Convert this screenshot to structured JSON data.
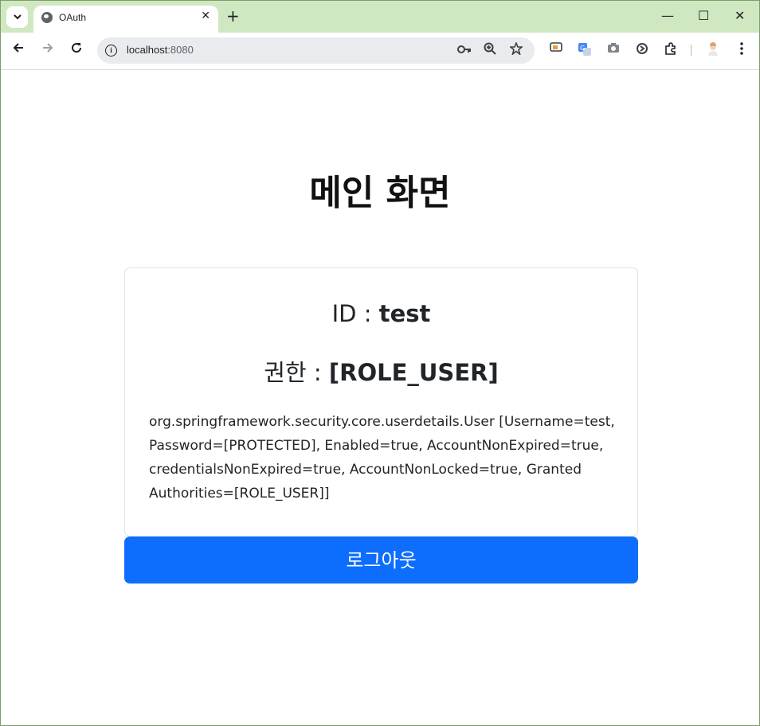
{
  "browser": {
    "tab_title": "OAuth",
    "tab_close": "✕",
    "new_tab": "+",
    "url_host": "localhost",
    "url_port": ":8080",
    "controls": {
      "minimize": "—",
      "maximize": "☐",
      "close": "✕"
    }
  },
  "main": {
    "heading": "메인 화면",
    "id_label": "ID : ",
    "id_value": "test",
    "role_label": "권한 : ",
    "role_value": "[ROLE_USER]",
    "detail_text": "org.springframework.security.core.userdetails.User [Username=test, Password=[PROTECTED], Enabled=true, AccountNonExpired=true, credentialsNonExpired=true, AccountNonLocked=true, Granted Authorities=[ROLE_USER]]",
    "logout_label": "로그아웃"
  },
  "colors": {
    "tabstrip": "#cfe8c2",
    "primary_button": "#0d6efd"
  },
  "icons": {
    "tab_search": "chevron-down-icon",
    "favicon": "globe-icon",
    "back": "back-arrow-icon",
    "forward": "forward-arrow-icon",
    "reload": "reload-icon",
    "site_info": "info-icon",
    "password": "key-icon",
    "zoom": "zoom-icon",
    "bookmark": "star-icon"
  }
}
